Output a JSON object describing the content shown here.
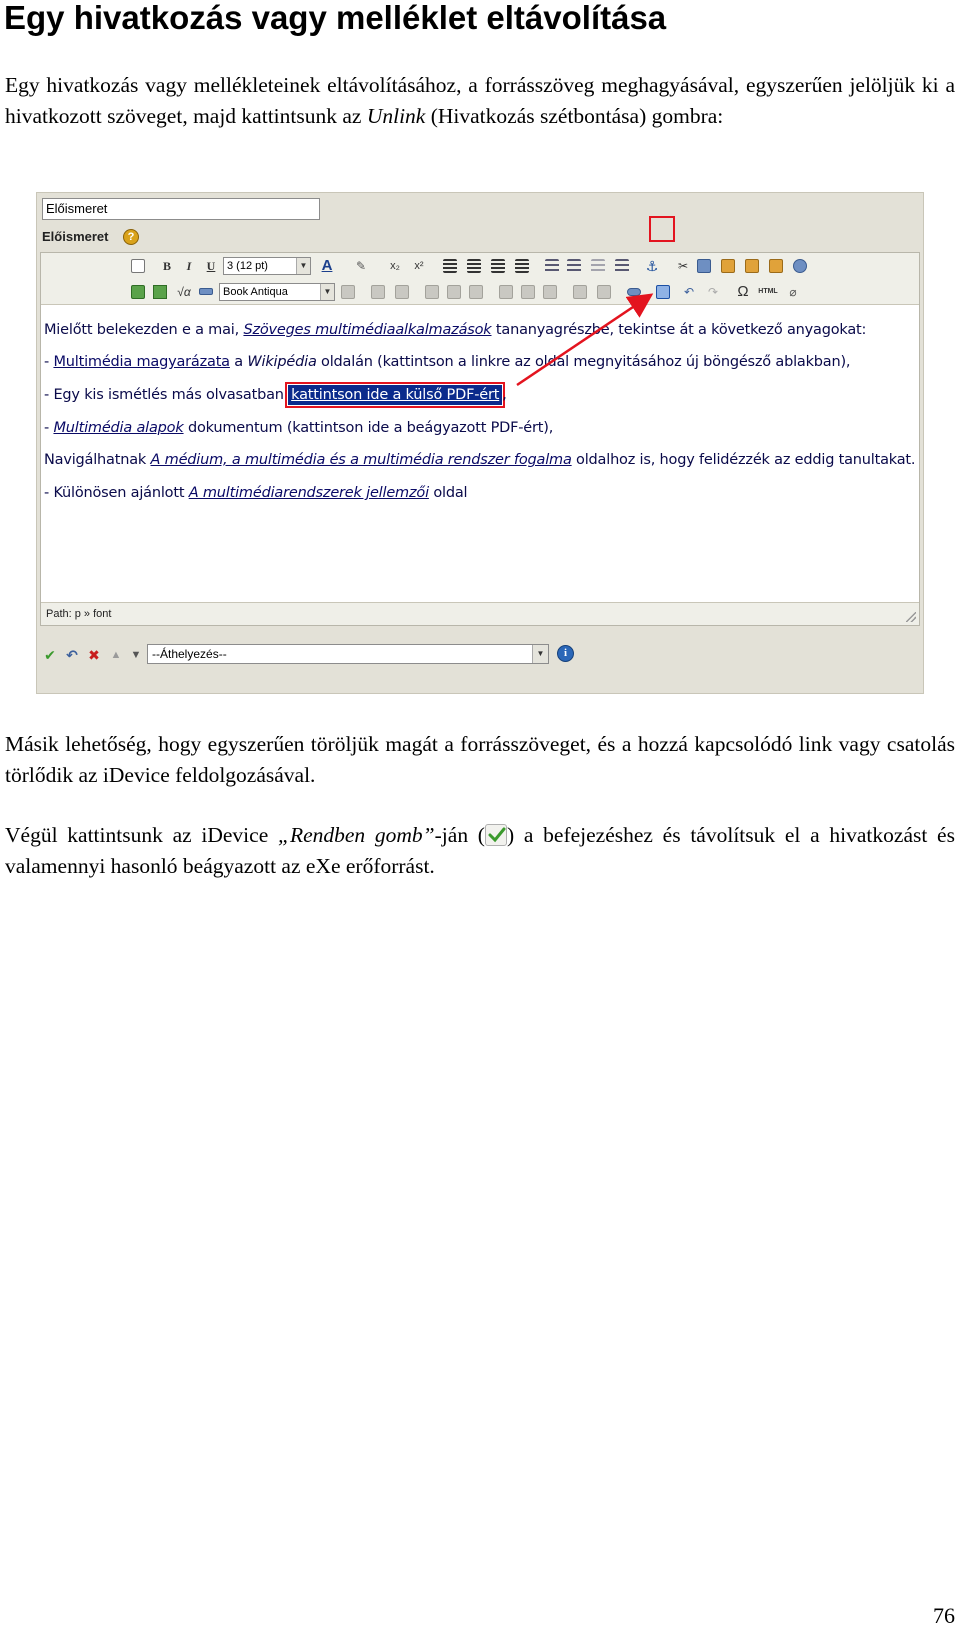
{
  "heading": "Egy hivatkozás vagy melléklet eltávolítása",
  "intro": {
    "before": "Egy hivatkozás vagy mellékleteinek eltávolításához, a forrásszöveg meghagyásával, egyszerűen jelöljük ki a hivatkozott szöveget, majd kattintsunk az ",
    "unlink": "Unlink",
    "after": " (Hivatkozás szétbontása) gombra:"
  },
  "screenshot": {
    "title_value": "Előismeret",
    "title_label": "Előismeret",
    "help_glyph": "?",
    "font_size_value": "3 (12 pt)",
    "font_family_value": "Book Antiqua",
    "lines": [
      {
        "a": "Mielőtt belekezden e a mai, ",
        "b": "Szöveges multimédiaalkalmazások",
        "c": " tananyagrészbe, tekintse át a következő anyagokat:"
      },
      {
        "a": "- ",
        "b": "Multimédia magyarázata",
        "c": " a ",
        "d": "Wikipédia",
        "e": " oldalán (kattintson a linkre az oldal megnyitásához új böngésző ablakban),"
      },
      {
        "a": "- Egy kis ismétlés más olvasatban ",
        "b": "kattintson ide a külső PDF-ért",
        "c": ","
      },
      {
        "a": "- ",
        "b": "Multimédia alapok",
        "c": " dokumentum (kattintson ide a beágyazott PDF-ért),"
      },
      {
        "a": "Navigálhatnak ",
        "b": "A médium, a multimédia és a multimédia rendszer fogalma",
        "c": " oldalhoz is, hogy felidézzék az eddig tanultakat."
      },
      {
        "a": "- Különösen ajánlott ",
        "b": "A multimédiarendszerek jellemzői",
        "c": " oldal"
      }
    ],
    "path": "Path: p » font",
    "move_select": "--Áthelyezés--",
    "info_glyph": "i"
  },
  "para2": "Másik lehetőség, hogy egyszerűen töröljük magát a forrásszöveget, és a hozzá kapcsolódó link vagy csatolás törlődik az iDevice feldolgozásával.",
  "para3": {
    "before": "Végül kattintsunk az iDevice ",
    "em": "„Rendben gomb”",
    "mid": "-ján (",
    "after": ") a befejezéshez és távolítsuk el a hivatkozást és valamennyi hasonló beágyazott az eXe erőforrást."
  },
  "page_number": "76",
  "colors": {
    "highlight": "#e3141f",
    "selection": "#0a2a8c"
  }
}
